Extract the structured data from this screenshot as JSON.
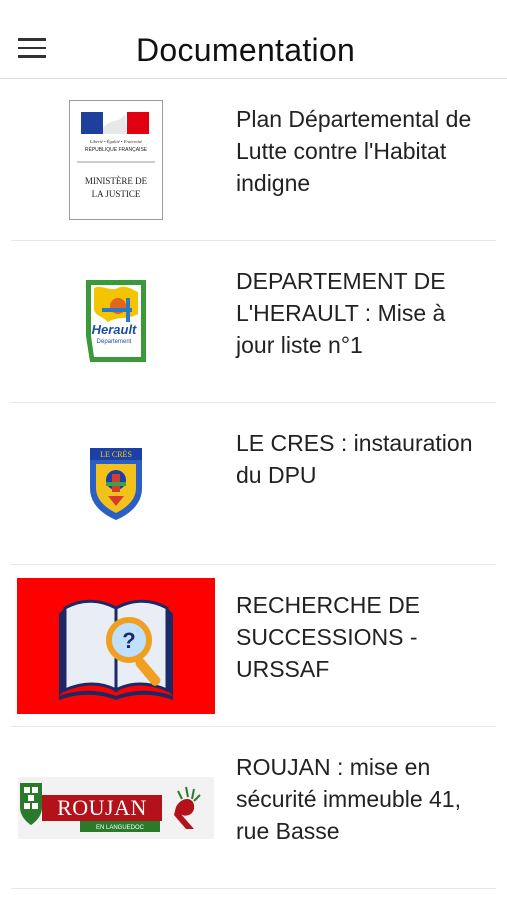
{
  "header": {
    "title": "Documentation",
    "menu_icon": "hamburger-menu-icon"
  },
  "items": [
    {
      "title": "Plan Départemental de Lutte contre l'Habitat indigne",
      "thumb": "ministere-justice-logo",
      "logo_text": {
        "l1": "Liberté • Égalité • Fraternité",
        "l2": "RÉPUBLIQUE FRANÇAISE",
        "l3": "MINISTÈRE DE",
        "l4": "LA JUSTICE"
      }
    },
    {
      "title": "DEPARTEMENT DE L'HERAULT : Mise à jour liste n°1",
      "thumb": "herault-departement-logo",
      "logo_text": {
        "l1": "Herault",
        "l2": "Département"
      }
    },
    {
      "title": "LE CRES : instauration du DPU",
      "thumb": "le-cres-coat-of-arms",
      "logo_text": {
        "l1": "LE CRÈS"
      }
    },
    {
      "title": "RECHERCHE DE SUCCESSIONS - URSSAF",
      "thumb": "book-magnifier-icon",
      "logo_text": {
        "l1": "?"
      }
    },
    {
      "title": "ROUJAN : mise en sécurité immeuble 41, rue Basse",
      "thumb": "roujan-logo",
      "logo_text": {
        "l1": "ROUJAN",
        "l2": "EN LANGUEDOC"
      }
    }
  ],
  "colors": {
    "republic_blue": "#1f3f9c",
    "republic_red": "#e1000f",
    "herault_green": "#3a9a3a",
    "herault_yellow": "#f5c400",
    "urssaf_red": "#ff0000",
    "roujan_red": "#b3121a"
  }
}
